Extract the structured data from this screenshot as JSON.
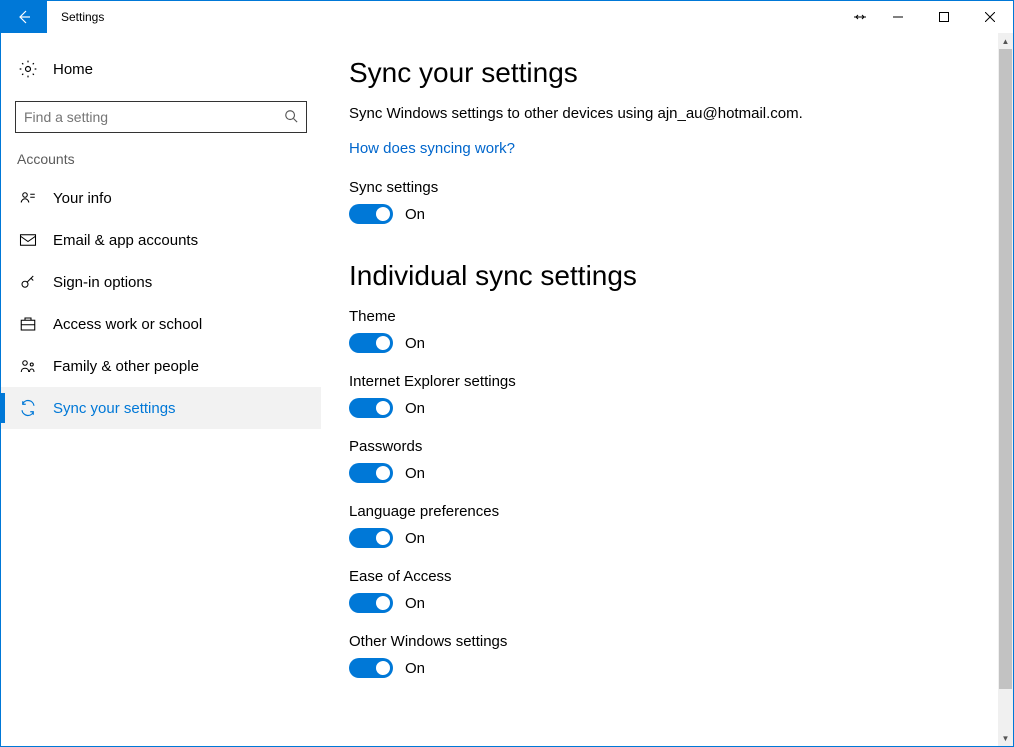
{
  "window": {
    "title": "Settings"
  },
  "sidebar": {
    "home": "Home",
    "search_placeholder": "Find a setting",
    "section": "Accounts",
    "items": [
      {
        "label": "Your info"
      },
      {
        "label": "Email & app accounts"
      },
      {
        "label": "Sign-in options"
      },
      {
        "label": "Access work or school"
      },
      {
        "label": "Family & other people"
      },
      {
        "label": "Sync your settings"
      }
    ]
  },
  "main": {
    "heading1": "Sync your settings",
    "description": "Sync Windows settings to other devices using ajn_au@hotmail.com.",
    "link": "How does syncing work?",
    "sync_settings_label": "Sync settings",
    "sync_settings_state": "On",
    "heading2": "Individual sync settings",
    "toggles": [
      {
        "label": "Theme",
        "state": "On"
      },
      {
        "label": "Internet Explorer settings",
        "state": "On"
      },
      {
        "label": "Passwords",
        "state": "On"
      },
      {
        "label": "Language preferences",
        "state": "On"
      },
      {
        "label": "Ease of Access",
        "state": "On"
      },
      {
        "label": "Other Windows settings",
        "state": "On"
      }
    ]
  }
}
